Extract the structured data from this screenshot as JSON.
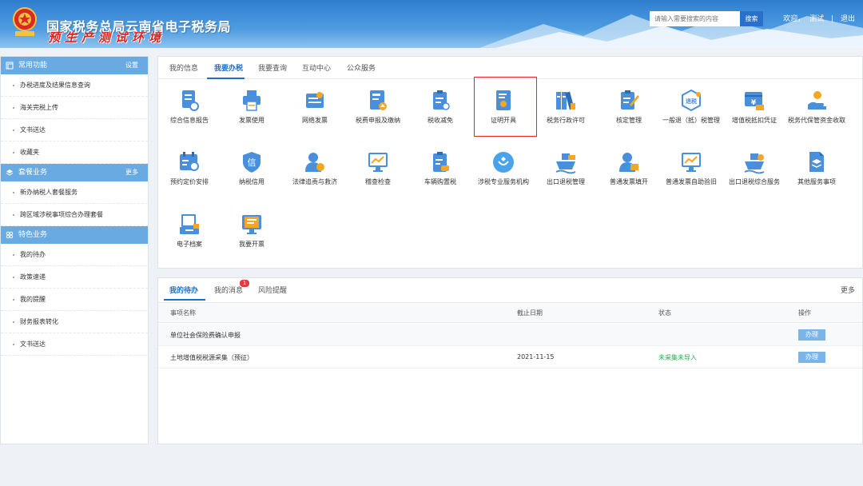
{
  "header": {
    "title": "国家税务总局云南省电子税务局",
    "subtitle": "预生产测试环境",
    "search_placeholder": "请输入需要搜索的内容",
    "search_button": "搜索",
    "welcome": "欢迎，",
    "user": "测试",
    "separator": "|",
    "logout": "退出"
  },
  "sidebar": {
    "sections": [
      {
        "title": "常用功能",
        "action": "设置",
        "items": [
          "办税进度及结果信息查询",
          "海关完税上传",
          "文书送达",
          "收藏夹"
        ]
      },
      {
        "title": "套餐业务",
        "action": "更多",
        "items": [
          "新办纳税人套餐服务",
          "跨区域涉税事项综合办理套餐"
        ]
      },
      {
        "title": "特色业务",
        "action": "",
        "items": [
          "我的待办",
          "政策速递",
          "我的提醒",
          "财务报表转化",
          "文书送达"
        ]
      }
    ]
  },
  "main": {
    "tabs": [
      "我的信息",
      "我要办税",
      "我要查询",
      "互动中心",
      "公众服务"
    ],
    "active_tab": "我要办税",
    "items": [
      {
        "label": "综合信息报告",
        "icon": "report-icon"
      },
      {
        "label": "发票使用",
        "icon": "printer-icon"
      },
      {
        "label": "网络发票",
        "icon": "network-invoice-icon"
      },
      {
        "label": "税费申报及缴纳",
        "icon": "declare-icon"
      },
      {
        "label": "税收减免",
        "icon": "tax-relief-icon"
      },
      {
        "label": "证明开具",
        "icon": "certificate-icon"
      },
      {
        "label": "税务行政许可",
        "icon": "binders-icon"
      },
      {
        "label": "核定管理",
        "icon": "approve-icon"
      },
      {
        "label": "一般退（抵）税管理",
        "icon": "refund-icon",
        "icon_text": "退税"
      },
      {
        "label": "增值税抵扣凭证",
        "icon": "voucher-icon",
        "icon_text": "¥"
      },
      {
        "label": "税务代保管资金收取",
        "icon": "custody-icon"
      },
      {
        "label": "预约定价安排",
        "icon": "calendar-icon"
      },
      {
        "label": "纳税信用",
        "icon": "credit-icon",
        "icon_text": "信"
      },
      {
        "label": "法律追责与救济",
        "icon": "legal-icon"
      },
      {
        "label": "稽查检查",
        "icon": "inspection-icon"
      },
      {
        "label": "车辆购置税",
        "icon": "vehicle-tax-icon"
      },
      {
        "label": "涉税专业服务机构",
        "icon": "agency-icon"
      },
      {
        "label": "出口退税管理",
        "icon": "export-ship-icon"
      },
      {
        "label": "普通发票填开",
        "icon": "invoice-fill-icon"
      },
      {
        "label": "普通发票自助验旧",
        "icon": "invoice-verify-icon"
      },
      {
        "label": "出口退税综合服务",
        "icon": "export-service-icon"
      },
      {
        "label": "其他服务事项",
        "icon": "other-service-icon"
      },
      {
        "label": "电子档案",
        "icon": "archive-icon"
      },
      {
        "label": "我要开票",
        "icon": "issue-invoice-icon"
      }
    ]
  },
  "todo": {
    "tabs": [
      "我的待办",
      "我的消息",
      "风险提醒"
    ],
    "message_count": "1",
    "more": "更多",
    "columns": [
      "事项名称",
      "截止日期",
      "状态",
      "操作"
    ],
    "rows": [
      {
        "name": "单位社会保险费确认申报",
        "deadline": "",
        "status": "",
        "action": "办理"
      },
      {
        "name": "土地增值税税源采集（预征）",
        "deadline": "2021-11-15",
        "status": "未采集未导入",
        "action": "办理"
      }
    ]
  },
  "colors": {
    "primary": "#1f6fc8",
    "sidebar_header": "#6aaae3",
    "highlight": "#e4262b",
    "status_green": "#2fa84f"
  }
}
